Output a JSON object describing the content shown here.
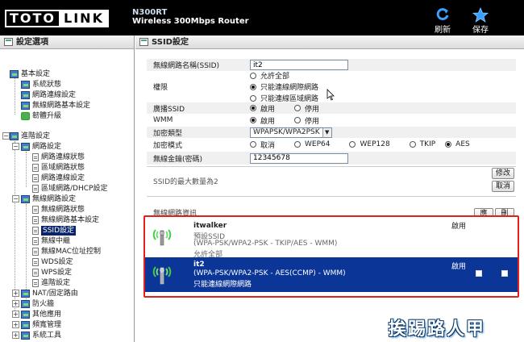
{
  "header": {
    "logo_left": "TOTO",
    "logo_right": "LINK",
    "model": "N300RT",
    "subtitle": "Wireless 300Mbps Router",
    "refresh_label": "刷新",
    "save_label": "保存"
  },
  "sidebar": {
    "title": "設定選項",
    "items": [
      {
        "label": "基本設定"
      },
      {
        "label": "系統狀態"
      },
      {
        "label": "網路連線設定"
      },
      {
        "label": "無線網路基本設定"
      },
      {
        "label": "韌體升級"
      },
      {
        "label": "進階設定"
      },
      {
        "label": "網路設定"
      },
      {
        "label": "網路連線狀態"
      },
      {
        "label": "區域網路狀態"
      },
      {
        "label": "網路連線設定"
      },
      {
        "label": "區域網路/DHCP設定"
      },
      {
        "label": "無線網路設定"
      },
      {
        "label": "無線網路狀態"
      },
      {
        "label": "無線網路基本設定"
      },
      {
        "label": "SSID設定"
      },
      {
        "label": "無線中繼"
      },
      {
        "label": "無線MAC位址控制"
      },
      {
        "label": "WDS設定"
      },
      {
        "label": "WPS設定"
      },
      {
        "label": "進階設定"
      },
      {
        "label": "NAT/固定路由"
      },
      {
        "label": "防火牆"
      },
      {
        "label": "其他應用"
      },
      {
        "label": "頻寬管理"
      },
      {
        "label": "系統工具"
      }
    ]
  },
  "main": {
    "title": "SSID設定",
    "ssid_label": "無線網路名稱(SSID)",
    "ssid_value": "it2",
    "perm_label": "權限",
    "perm_options": [
      "允許全部",
      "只能連線網際網路",
      "只能連線區域網路"
    ],
    "broadcast_label": "廣播SSID",
    "wmm_label": "WMM",
    "enable": "啟用",
    "disable": "停用",
    "enc_type_label": "加密類型",
    "enc_type_value": "WPAPSK/WPA2PSK",
    "enc_mode_label": "加密模式",
    "enc_modes": [
      "取消",
      "WEP64",
      "WEP128",
      "TKIP",
      "AES"
    ],
    "key_label": "無線金鑰(密碼)",
    "key_value": "12345678",
    "note": "SSID的最大數量為2",
    "modify_button": "修改",
    "cancel_button": "取消",
    "list_label": "無線網路資訊",
    "apply_button": "應用",
    "delete_button": "刪除"
  },
  "entries": [
    {
      "name": "itwalker",
      "line2": "預設SSID",
      "line3": "(WPA-PSK/WPA2-PSK - TKIP/AES - WMM)",
      "line4": "允許全部",
      "status": "啟用"
    },
    {
      "name": "it2",
      "line2": "(WPA-PSK/WPA2-PSK - AES(CCMP) - WMM)",
      "line3": "只能連線網際網路",
      "status": "啟用"
    }
  ],
  "watermark": "挨踢路人甲"
}
